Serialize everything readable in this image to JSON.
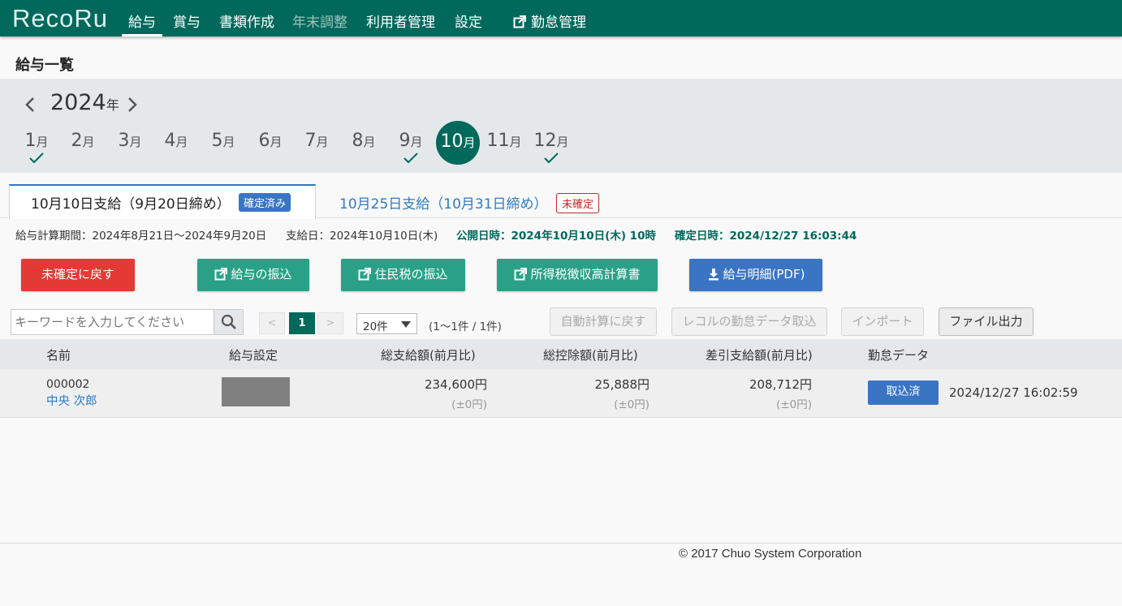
{
  "app": {
    "logo": "RecoRu"
  },
  "nav": {
    "items": [
      {
        "label": "給与",
        "active": true
      },
      {
        "label": "賞与"
      },
      {
        "label": "書類作成"
      },
      {
        "label": "年末調整",
        "disabled": true
      },
      {
        "label": "利用者管理"
      },
      {
        "label": "設定"
      }
    ],
    "external_label": "勤怠管理"
  },
  "page": {
    "title": "給与一覧"
  },
  "calendar": {
    "year": "2024",
    "year_unit": "年",
    "month_unit": "月",
    "months": [
      {
        "num": "1",
        "checked": true
      },
      {
        "num": "2"
      },
      {
        "num": "3"
      },
      {
        "num": "4"
      },
      {
        "num": "5"
      },
      {
        "num": "6"
      },
      {
        "num": "7"
      },
      {
        "num": "8"
      },
      {
        "num": "9",
        "checked": true
      },
      {
        "num": "10",
        "selected": true
      },
      {
        "num": "11"
      },
      {
        "num": "12",
        "checked": true
      }
    ]
  },
  "tabs": [
    {
      "label": "10月10日支給（9月20日締め）",
      "badge": "確定済み",
      "active": true
    },
    {
      "label": "10月25日支給（10月31日締め）",
      "badge": "未確定"
    }
  ],
  "info": {
    "period": "給与計算期間：2024年8月21日～2024年9月20日",
    "payday": "支給日：2024年10月10日(木)",
    "published": "公開日時：2024年10月10日(木) 10時",
    "confirmed": "確定日時：2024/12/27 16:03:44"
  },
  "actions": {
    "revert": "未確定に戻す",
    "salary_transfer": "給与の振込",
    "resident_tax_transfer": "住民税の振込",
    "withholding_calc": "所得税徴収高計算書",
    "payslip_pdf": "給与明細(PDF)"
  },
  "toolbar": {
    "search_placeholder": "キーワードを入力してください",
    "page_prev": "<",
    "page_current": "1",
    "page_next": ">",
    "per_page": "20件",
    "count": "(1～1件 / 1件)",
    "auto_calc": "自動計算に戻す",
    "recoru_import": "レコルの勤怠データ取込",
    "import": "インポート",
    "export": "ファイル出力"
  },
  "table": {
    "headers": {
      "name": "名前",
      "salary_setting": "給与設定",
      "gross": "総支給額(前月比)",
      "deduction": "総控除額(前月比)",
      "net": "差引支給額(前月比)",
      "attendance": "勤怠データ"
    },
    "rows": [
      {
        "employee_no": "000002",
        "name": "中央 次郎",
        "gross": "234,600円",
        "gross_diff": "(±0円)",
        "deduction": "25,888円",
        "deduction_diff": "(±0円)",
        "net": "208,712円",
        "net_diff": "(±0円)",
        "attendance_status": "取込済",
        "attendance_time": "2024/12/27 16:02:59"
      }
    ]
  },
  "footer": {
    "copyright": "© 2017 Chuo System Corporation"
  },
  "colors": {
    "brand": "#00695c",
    "danger": "#e53935",
    "accent": "#3a75c4",
    "action": "#2aa187"
  }
}
